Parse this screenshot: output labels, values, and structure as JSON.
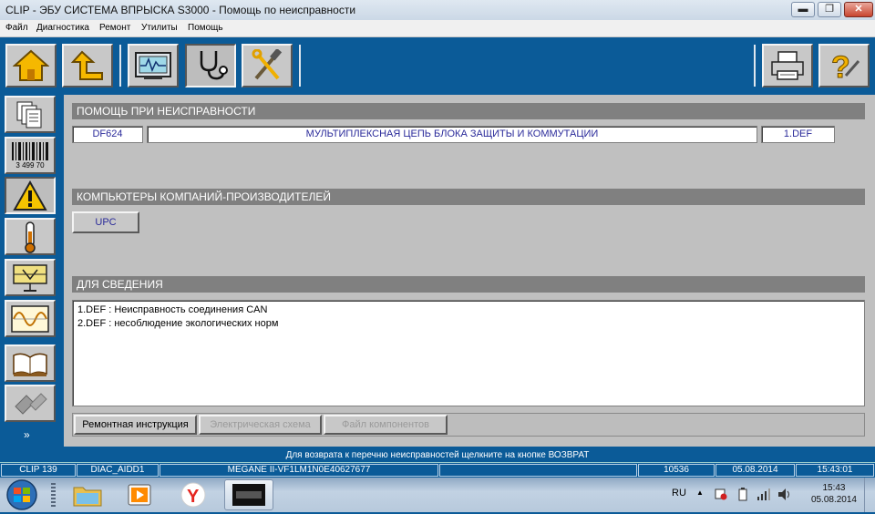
{
  "window": {
    "title": "CLIP - ЭБУ СИСТЕМА ВПРЫСКА S3000 - Помощь по неисправности",
    "minimize": "▬",
    "maximize": "❐",
    "close": "✕"
  },
  "menu": [
    "Файл",
    "Диагностика",
    "Ремонт",
    "Утилиты",
    "Помощь"
  ],
  "toolbar": {
    "left": [
      {
        "name": "home-button",
        "icon": "home-icon"
      },
      {
        "name": "back-button",
        "icon": "back-arrow-icon"
      },
      {
        "name": "measure-button",
        "icon": "oscilloscope-icon"
      },
      {
        "name": "diagnostic-button",
        "icon": "stethoscope-icon"
      },
      {
        "name": "repair-button",
        "icon": "tools-icon"
      }
    ],
    "right": [
      {
        "name": "print-button",
        "icon": "printer-icon"
      },
      {
        "name": "help-button",
        "icon": "help-icon"
      }
    ]
  },
  "sidebar": [
    {
      "name": "documents-icon"
    },
    {
      "name": "barcode-icon",
      "text": "3 499 70"
    },
    {
      "name": "warning-icon"
    },
    {
      "name": "thermometer-icon"
    },
    {
      "name": "actuator-icon"
    },
    {
      "name": "waveform-icon"
    },
    {
      "name": "manual-book-icon"
    },
    {
      "name": "connector-icon"
    }
  ],
  "sidebar_more": "»",
  "fault_help": {
    "header": "ПОМОЩЬ ПРИ НЕИСПРАВНОСТИ",
    "code": "DF624",
    "description": "МУЛЬТИПЛЕКСНАЯ ЦЕПЬ БЛОКА ЗАЩИТЫ И КОММУТАЦИИ",
    "def": "1.DEF"
  },
  "computers": {
    "header": "КОМПЬЮТЕРЫ КОМПАНИЙ-ПРОИЗВОДИТЕЛЕЙ",
    "button": "UPC"
  },
  "info": {
    "header": "ДЛЯ СВЕДЕНИЯ",
    "lines": [
      "1.DEF  :  Неисправность соединения CAN",
      "2.DEF  :  несоблюдение экологических норм"
    ]
  },
  "tabs": [
    {
      "label": "Ремонтная инструкция",
      "enabled": true
    },
    {
      "label": "Электрическая схема",
      "enabled": false
    },
    {
      "label": "Файл компонентов",
      "enabled": false
    }
  ],
  "hint": "Для возврата к перечню неисправностей щелкните на кнопке ВОЗВРАТ",
  "status": {
    "clip": "CLIP 139",
    "ecu": "DIAC_AIDD1",
    "vehicle": "MEGANE II-VF1LM1N0E40627677",
    "code": "10536",
    "date": "05.08.2014",
    "time": "15:43:01"
  },
  "taskbar": {
    "lang": "RU",
    "time": "15:43",
    "date": "05.08.2014",
    "tray_arrow": "▲",
    "apps": [
      "explorer-icon",
      "media-player-icon",
      "yandex-browser-icon",
      "clip-app-icon"
    ]
  },
  "colors": {
    "frame_blue": "#0b5b98",
    "panel_grey": "#c0c0c0",
    "header_grey": "#808080",
    "field_text": "#2a2a9a"
  }
}
